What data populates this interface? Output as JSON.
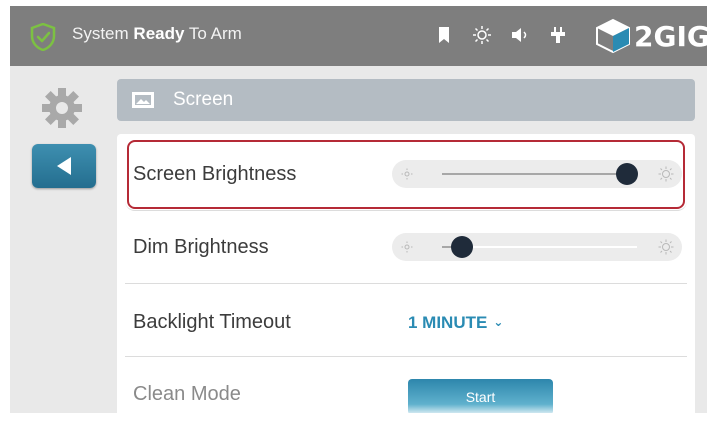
{
  "status_bar": {
    "status_prefix": "System",
    "status_bold": "Ready",
    "status_suffix": "To Arm",
    "brand": "2GIG",
    "icons": [
      "bookmark-icon",
      "brightness-icon",
      "volume-icon",
      "plug-icon"
    ]
  },
  "header": {
    "title": "Screen",
    "icon": "screen-settings-icon"
  },
  "settings": {
    "screen_brightness": {
      "label": "Screen Brightness",
      "level": 0.95
    },
    "dim_brightness": {
      "label": "Dim Brightness",
      "level": 0.1
    },
    "backlight_timeout": {
      "label": "Backlight Timeout",
      "value": "1 MINUTE"
    },
    "clean_mode": {
      "label": "Clean Mode",
      "button_label": "Start"
    }
  },
  "colors": {
    "accent": "#2a8bb3",
    "topbar": "#7e7e7e",
    "highlight_border": "#b52a36",
    "shield_green": "#7cc142"
  }
}
